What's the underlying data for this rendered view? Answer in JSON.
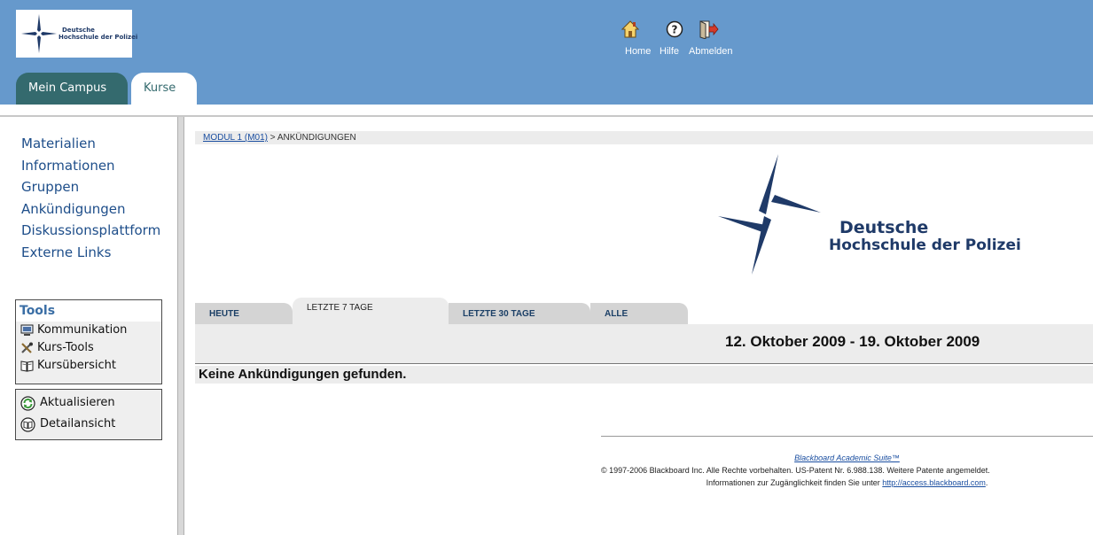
{
  "header": {
    "logo": {
      "line1": "Deutsche",
      "line2": "Hochschule der Polizei"
    },
    "nav": [
      {
        "label": "Home",
        "icon": "home-icon"
      },
      {
        "label": "Hilfe",
        "icon": "help-icon"
      },
      {
        "label": "Abmelden",
        "icon": "logout-icon"
      }
    ],
    "tabs": [
      {
        "label": "Mein Campus",
        "active": false
      },
      {
        "label": "Kurse",
        "active": true
      }
    ],
    "colors": {
      "header_bg": "#6699cc",
      "tab_dark": "#346a6e",
      "link": "#1e4e8a"
    }
  },
  "sidebar": {
    "course_menu": [
      "Materialien",
      "Informationen",
      "Gruppen",
      "Ankündigungen",
      "Diskussionsplattform",
      "Externe Links"
    ],
    "tools": {
      "title": "Tools",
      "items": [
        {
          "label": "Kommunikation",
          "icon": "monitor-icon"
        },
        {
          "label": "Kurs-Tools",
          "icon": "tools-icon"
        },
        {
          "label": "Kursübersicht",
          "icon": "book-icon"
        }
      ]
    },
    "actions": [
      {
        "label": "Aktualisieren",
        "icon": "refresh-icon"
      },
      {
        "label": "Detailansicht",
        "icon": "detail-icon"
      }
    ]
  },
  "main": {
    "breadcrumb": {
      "link": "MODUL 1 (M01)",
      "separator": ">",
      "current": "ANKÜNDIGUNGEN"
    },
    "banner": {
      "line1": "Deutsche",
      "line2": "Hochschule der Polizei"
    },
    "date_tabs": [
      {
        "label": "HEUTE",
        "active": false
      },
      {
        "label": "LETZTE 7 TAGE",
        "active": true
      },
      {
        "label": "LETZTE 30 TAGE",
        "active": false
      },
      {
        "label": "ALLE",
        "active": false
      }
    ],
    "date_range": "12. Oktober 2009 - 19. Oktober 2009",
    "empty_message": "Keine Ankündigungen gefunden."
  },
  "footer": {
    "product": "Blackboard Academic Suite™",
    "copyright": "© 1997-2006 Blackboard Inc. Alle Rechte vorbehalten. US-Patent Nr. 6.988.138. Weitere Patente angemeldet.",
    "accessibility_prefix": "Informationen zur Zugänglichkeit finden Sie unter",
    "accessibility_link": "http://access.blackboard.com",
    "accessibility_suffix": "."
  }
}
